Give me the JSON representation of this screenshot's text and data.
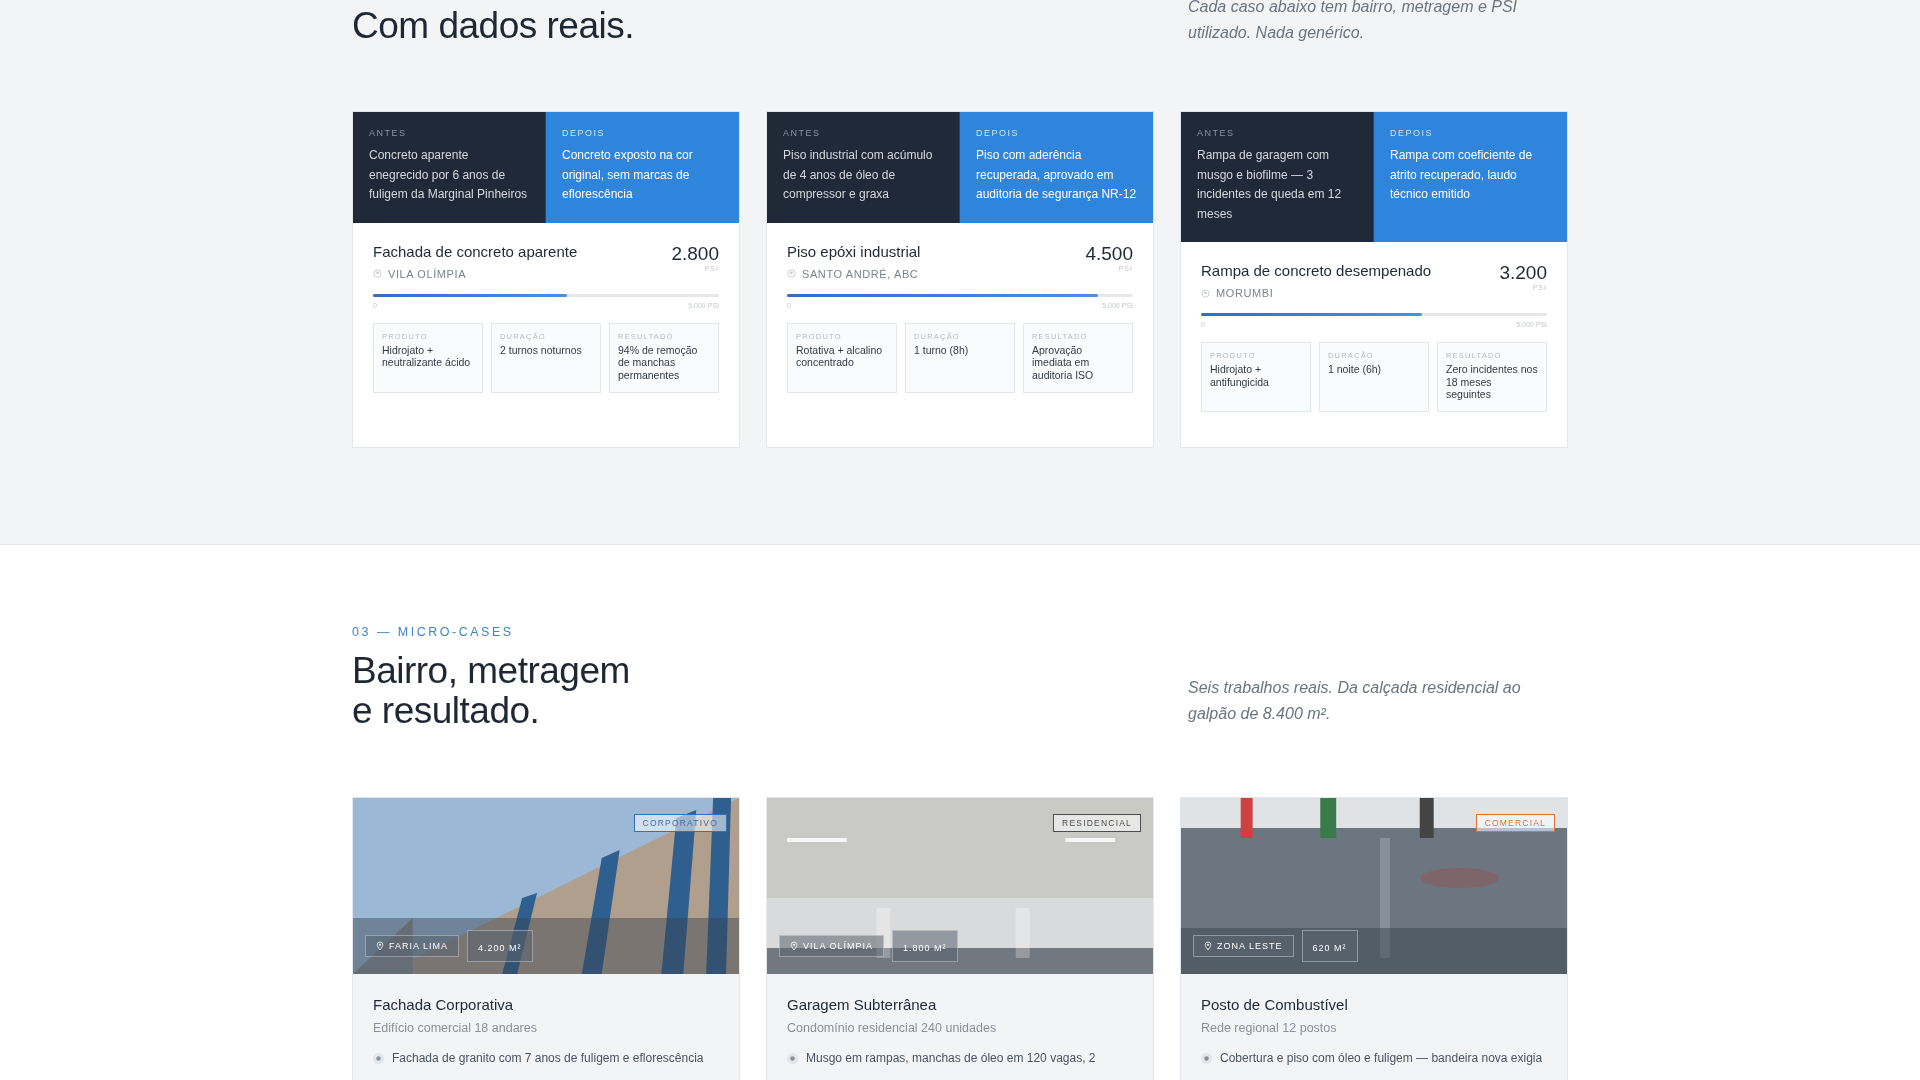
{
  "intro": {
    "title": "Com dados reais.",
    "lead": "Cada caso abaixo tem bairro, metragem e PSI utilizado. Nada genérico."
  },
  "cases": [
    {
      "before_label": "ANTES",
      "before": "Concreto aparente enegrecido por 6 anos de fuligem da Marginal Pinheiros",
      "after_label": "DEPOIS",
      "after": "Concreto exposto na cor original, sem marcas de eflorescência",
      "title": "Fachada de concreto aparente",
      "location": "VILA OLÍMPIA",
      "psi": "2.800",
      "unit": "PSI",
      "level": 0.56,
      "scale_min": "0",
      "scale_max": "5.000 PSI",
      "meta": [
        {
          "label": "PRODUTO",
          "value": "Hidrojato + neutralizante ácido"
        },
        {
          "label": "DURAÇÃO",
          "value": "2 turnos noturnos"
        },
        {
          "label": "RESULTADO",
          "value": "94% de remoção de manchas permanentes"
        }
      ]
    },
    {
      "before_label": "ANTES",
      "before": "Piso industrial com acúmulo de 4 anos de óleo de compressor e graxa",
      "after_label": "DEPOIS",
      "after": "Piso com aderência recuperada, aprovado em auditoria de segurança NR-12",
      "title": "Piso epóxi industrial",
      "location": "SANTO ANDRÉ, ABC",
      "psi": "4.500",
      "unit": "PSI",
      "level": 0.9,
      "scale_min": "0",
      "scale_max": "5.000 PSI",
      "meta": [
        {
          "label": "PRODUTO",
          "value": "Rotativa + alcalino concentrado"
        },
        {
          "label": "DURAÇÃO",
          "value": "1 turno (8h)"
        },
        {
          "label": "RESULTADO",
          "value": "Aprovação imediata em auditoria ISO"
        }
      ]
    },
    {
      "before_label": "ANTES",
      "before": "Rampa de garagem com musgo e biofilme — 3 incidentes de queda em 12 meses",
      "after_label": "DEPOIS",
      "after": "Rampa com coeficiente de atrito recuperado, laudo técnico emitido",
      "title": "Rampa de concreto desempenado",
      "location": "MORUMBI",
      "psi": "3.200",
      "unit": "PSI",
      "level": 0.64,
      "scale_min": "0",
      "scale_max": "5.000 PSI",
      "meta": [
        {
          "label": "PRODUTO",
          "value": "Hidrojato + antifungicida"
        },
        {
          "label": "DURAÇÃO",
          "value": "1 noite (6h)"
        },
        {
          "label": "RESULTADO",
          "value": "Zero incidentes nos 18 meses seguintes"
        }
      ]
    }
  ],
  "micro": {
    "eyebrow": "03 — MICRO-CASES",
    "title": "Bairro, metragem e resultado.",
    "lead": "Seis trabalhos reais. Da calçada residencial ao galpão de 8.400 m².",
    "cards": [
      {
        "tag": {
          "label": "CORPORATIVO",
          "color": "#3b6fb0"
        },
        "location": "FARIA LIMA",
        "area": "4.200 M²",
        "title": "Fachada Corporativa",
        "subtitle": "Edifício comercial 18 andares",
        "bullet": "Fachada de granito com 7 anos de fuligem e eflorescência"
      },
      {
        "tag": {
          "label": "RESIDENCIAL",
          "color": "#4b4f55"
        },
        "location": "VILA OLÍMPIA",
        "area": "1.800 M²",
        "title": "Garagem Subterrânea",
        "subtitle": "Condomínio residencial 240 unidades",
        "bullet": "Musgo em rampas, manchas de óleo em 120 vagas, 2"
      },
      {
        "tag": {
          "label": "COMERCIAL",
          "color": "#d9703a"
        },
        "location": "ZONA LESTE",
        "area": "620 M²",
        "title": "Posto de Combustível",
        "subtitle": "Rede regional 12 postos",
        "bullet": "Cobertura e piso com óleo e fuligem — bandeira nova exigia"
      }
    ]
  }
}
